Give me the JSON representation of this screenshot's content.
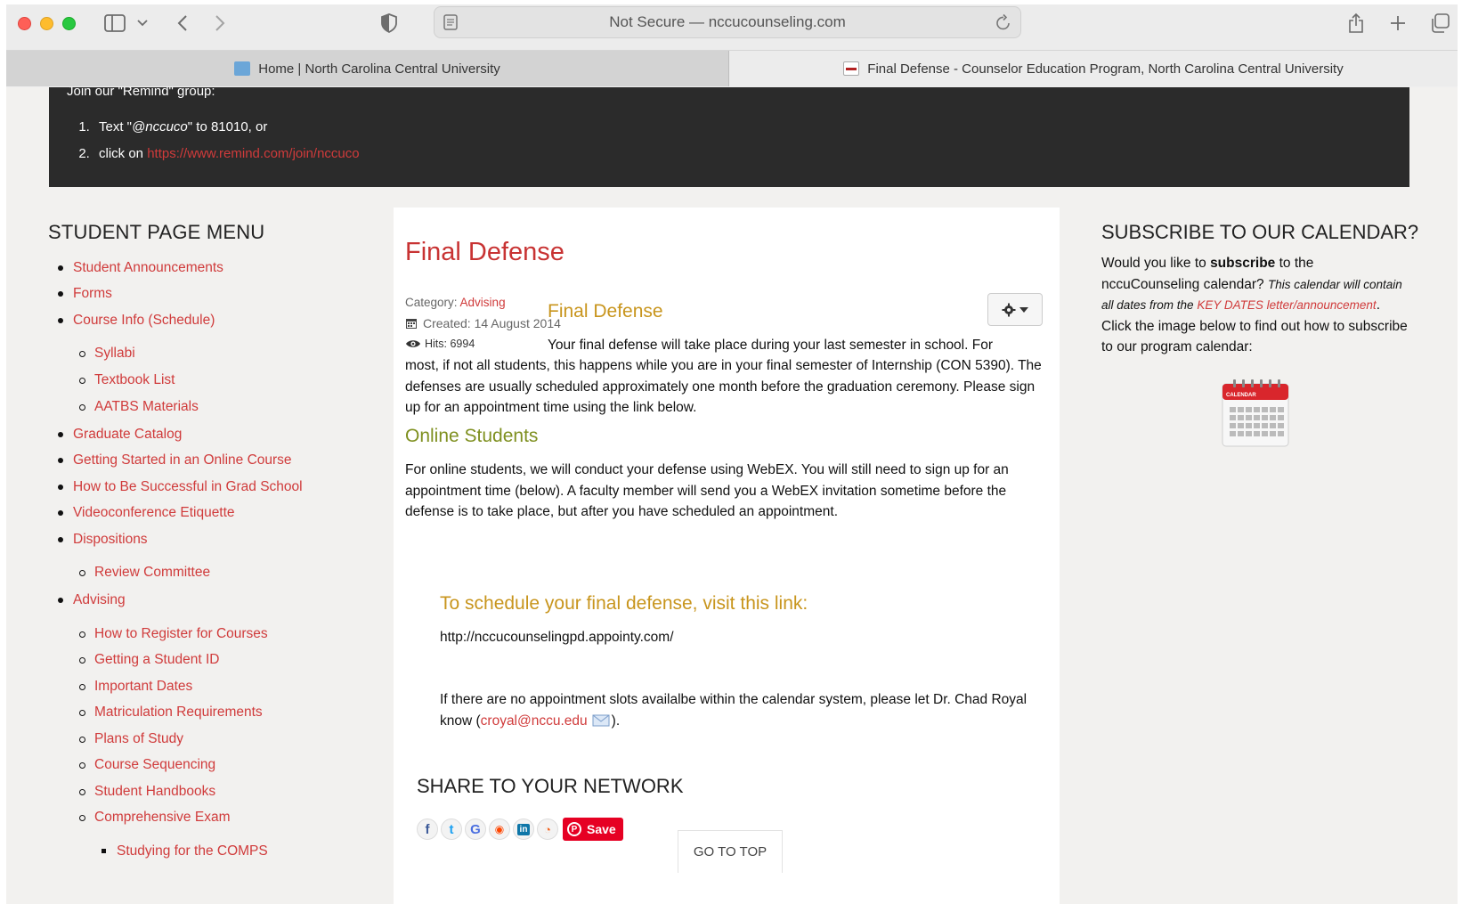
{
  "browser": {
    "address": "Not Secure — nccucounseling.com",
    "tabs": [
      {
        "label": "Home | North Carolina Central University"
      },
      {
        "label": "Final Defense - Counselor Education Program, North Carolina Central University"
      }
    ]
  },
  "remind": {
    "intro": "Join our \"Remind\" group:",
    "step1_prefix": "Text \"",
    "step1_code": "@nccuco",
    "step1_suffix": "\" to 81010, or",
    "step2_prefix": "click on ",
    "step2_link": "https://www.remind.com/join/nccuco"
  },
  "menu": {
    "title": "STUDENT PAGE MENU",
    "items": [
      {
        "label": "Student Announcements",
        "level": 1
      },
      {
        "label": "Forms",
        "level": 1
      },
      {
        "label": "Course Info (Schedule)",
        "level": 1
      },
      {
        "label": "Syllabi",
        "level": 2
      },
      {
        "label": "Textbook List",
        "level": 2
      },
      {
        "label": "AATBS Materials",
        "level": 2
      },
      {
        "label": "Graduate Catalog",
        "level": 1
      },
      {
        "label": "Getting Started in an Online Course",
        "level": 1
      },
      {
        "label": "How to Be Successful in Grad School",
        "level": 1
      },
      {
        "label": "Videoconference Etiquette",
        "level": 1
      },
      {
        "label": "Dispositions",
        "level": 1
      },
      {
        "label": "Review Committee",
        "level": 2
      },
      {
        "label": "Advising",
        "level": 1
      },
      {
        "label": "How to Register for Courses",
        "level": 2
      },
      {
        "label": "Getting a Student ID",
        "level": 2
      },
      {
        "label": "Important Dates",
        "level": 2
      },
      {
        "label": "Matriculation Requirements",
        "level": 2
      },
      {
        "label": "Plans of Study",
        "level": 2
      },
      {
        "label": "Course Sequencing",
        "level": 2
      },
      {
        "label": "Student Handbooks",
        "level": 2
      },
      {
        "label": "Comprehensive Exam",
        "level": 2
      },
      {
        "label": "Studying for the COMPS",
        "level": 3
      }
    ]
  },
  "article": {
    "title": "Final Defense",
    "category_label": "Category: ",
    "category_value": "Advising",
    "created": "Created: 14 August 2014",
    "hits": "Hits: 6994",
    "heading1": "Final Defense",
    "para1_first": "Your final defense will take place during your last semester in school.  For",
    "para1_rest": "most, if not all students, this happens while you are in your final semester of Internship (CON 5390).  The defenses are usually scheduled approximately one month before the graduation ceremony.  Please sign up for an appointment time using the link below.",
    "heading2": "Online Students",
    "para2": "For online students, we will conduct your defense using WebEX.  You will still need to sign up for an appointment time (below).  A faculty member will send you a WebEX invitation sometime before the defense is to take place, but after you have scheduled an appointment.",
    "schedule_heading": "To schedule your final defense, visit this link:",
    "schedule_link": "http://nccucounselingpd.appointy.com/",
    "note_text": "If there are no appointment slots availalbe within the calendar system, please let Dr. Chad Royal know (",
    "note_email": "croyal@nccu.edu",
    "note_end": ").",
    "share_title": "SHARE TO YOUR NETWORK",
    "pin_save": "Save",
    "go_top": "GO TO TOP"
  },
  "subscribe": {
    "title": "SUBSCRIBE TO OUR CALENDAR?",
    "t1": "Would you like to ",
    "t1_bold": "subscribe",
    "t2": " to the nccuCounseling calendar?  ",
    "t3_italic": "This calendar will contain all dates from the ",
    "t3_link": "KEY DATES letter/announcement",
    "t4": ".  Click the image below to find out how to subscribe to our program calendar:",
    "calendar_label": "CALENDAR"
  },
  "colors": {
    "accent_red": "#d03b3b",
    "gold": "#c8951d",
    "olive": "#7f9020",
    "dark_band": "#2b2b2b"
  }
}
